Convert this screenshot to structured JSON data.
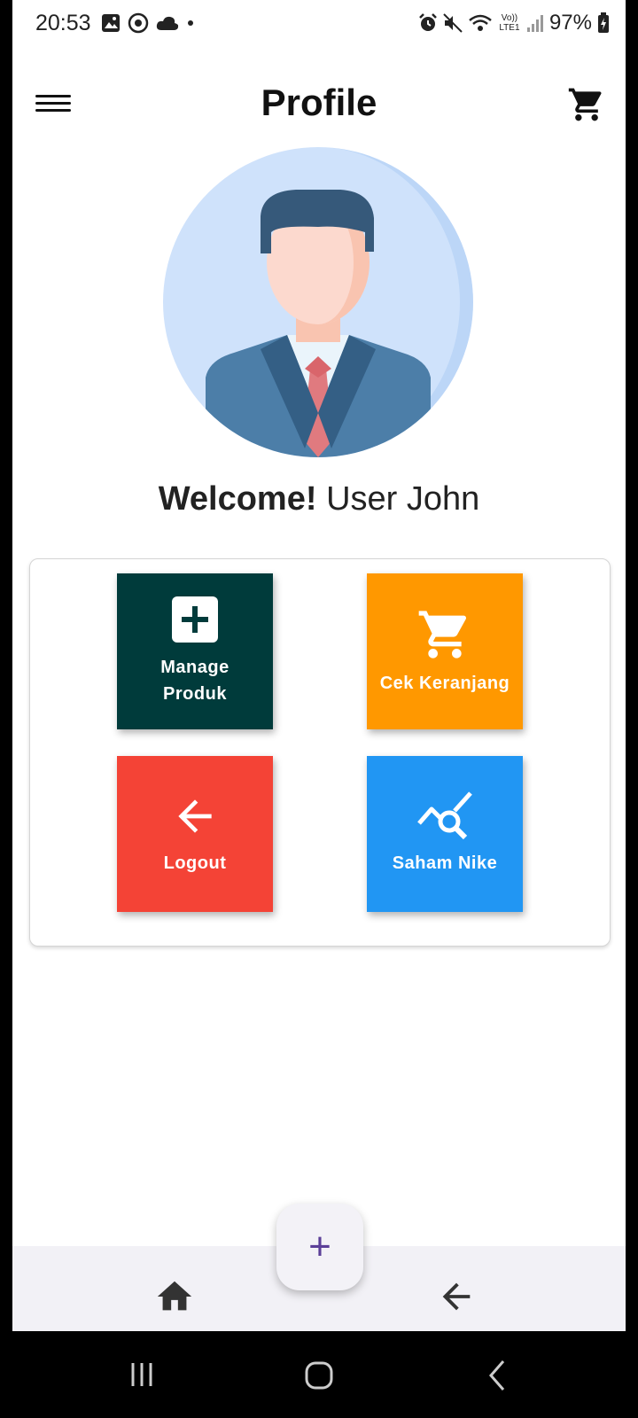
{
  "status_bar": {
    "time": "20:53",
    "battery": "97%",
    "network": "Vo)) LTE1"
  },
  "app_bar": {
    "title": "Profile"
  },
  "welcome": {
    "bold": "Welcome!",
    "name": "User John"
  },
  "menu": {
    "items": [
      {
        "label": "Manage Produk",
        "icon": "add-box-icon",
        "color": "#003b3b"
      },
      {
        "label": "Cek Keranjang",
        "icon": "shopping-cart-icon",
        "color": "#ff9800"
      },
      {
        "label": "Logout",
        "icon": "arrow-back-icon",
        "color": "#f44336"
      },
      {
        "label": "Saham Nike",
        "icon": "query-stats-icon",
        "color": "#2196f3"
      }
    ]
  },
  "fab": {
    "symbol": "+"
  },
  "colors": {
    "fab_plus": "#5b3f98",
    "nav_icon": "#333333"
  }
}
